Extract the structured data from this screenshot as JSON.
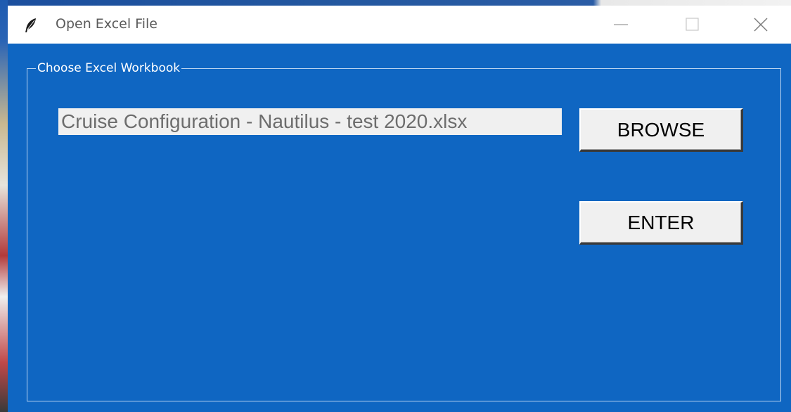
{
  "window": {
    "title": "Open Excel File",
    "icon": "feather-icon",
    "controls": [
      "minimize-icon",
      "maximize-icon",
      "close-icon"
    ]
  },
  "groupbox": {
    "label": "Choose Excel Workbook"
  },
  "file_entry": {
    "value": "Cruise Configuration - Nautilus - test 2020.xlsx"
  },
  "buttons": {
    "browse": "BROWSE",
    "enter": "ENTER"
  },
  "colors": {
    "window_background": "#0f66c2",
    "titlebar": "#ffffff",
    "button_face": "#f0f0f0",
    "entry_background": "#f0f0f0"
  }
}
